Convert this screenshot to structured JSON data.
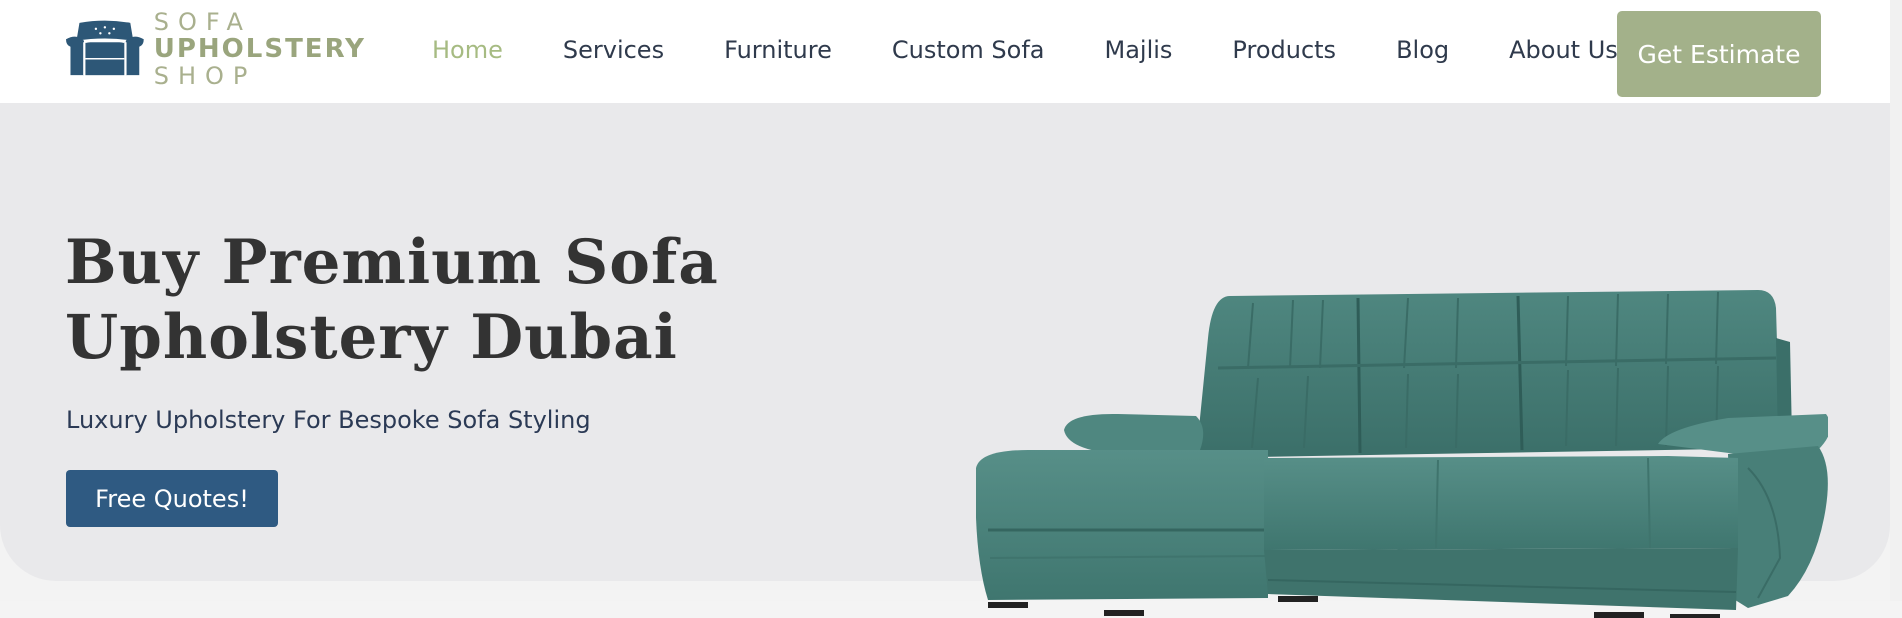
{
  "logo": {
    "line1": "SOFA",
    "line2": "UPHOLSTERY",
    "line3": "SHOP",
    "icon": "armchair-icon"
  },
  "nav": {
    "items": [
      {
        "label": "Home",
        "active": true
      },
      {
        "label": "Services",
        "active": false
      },
      {
        "label": "Furniture",
        "active": false
      },
      {
        "label": "Custom Sofa",
        "active": false
      },
      {
        "label": "Majlis",
        "active": false
      },
      {
        "label": "Products",
        "active": false
      },
      {
        "label": "Blog",
        "active": false
      },
      {
        "label": "About Us",
        "active": false
      }
    ],
    "cta_label": "Get Estimate"
  },
  "hero": {
    "title_line1": "Buy Premium Sofa",
    "title_line2": "Upholstery Dubai",
    "subtitle": "Luxury Upholstery For Bespoke Sofa Styling",
    "button_label": "Free Quotes!",
    "image": "sectional-sofa-image"
  },
  "colors": {
    "accent_green": "#a3b18a",
    "active_nav": "#a6bb82",
    "primary_blue": "#2f5a82",
    "nav_text": "#2f3a4c",
    "hero_bg": "#e9e9eb",
    "sofa_teal": "#4f8a83"
  }
}
